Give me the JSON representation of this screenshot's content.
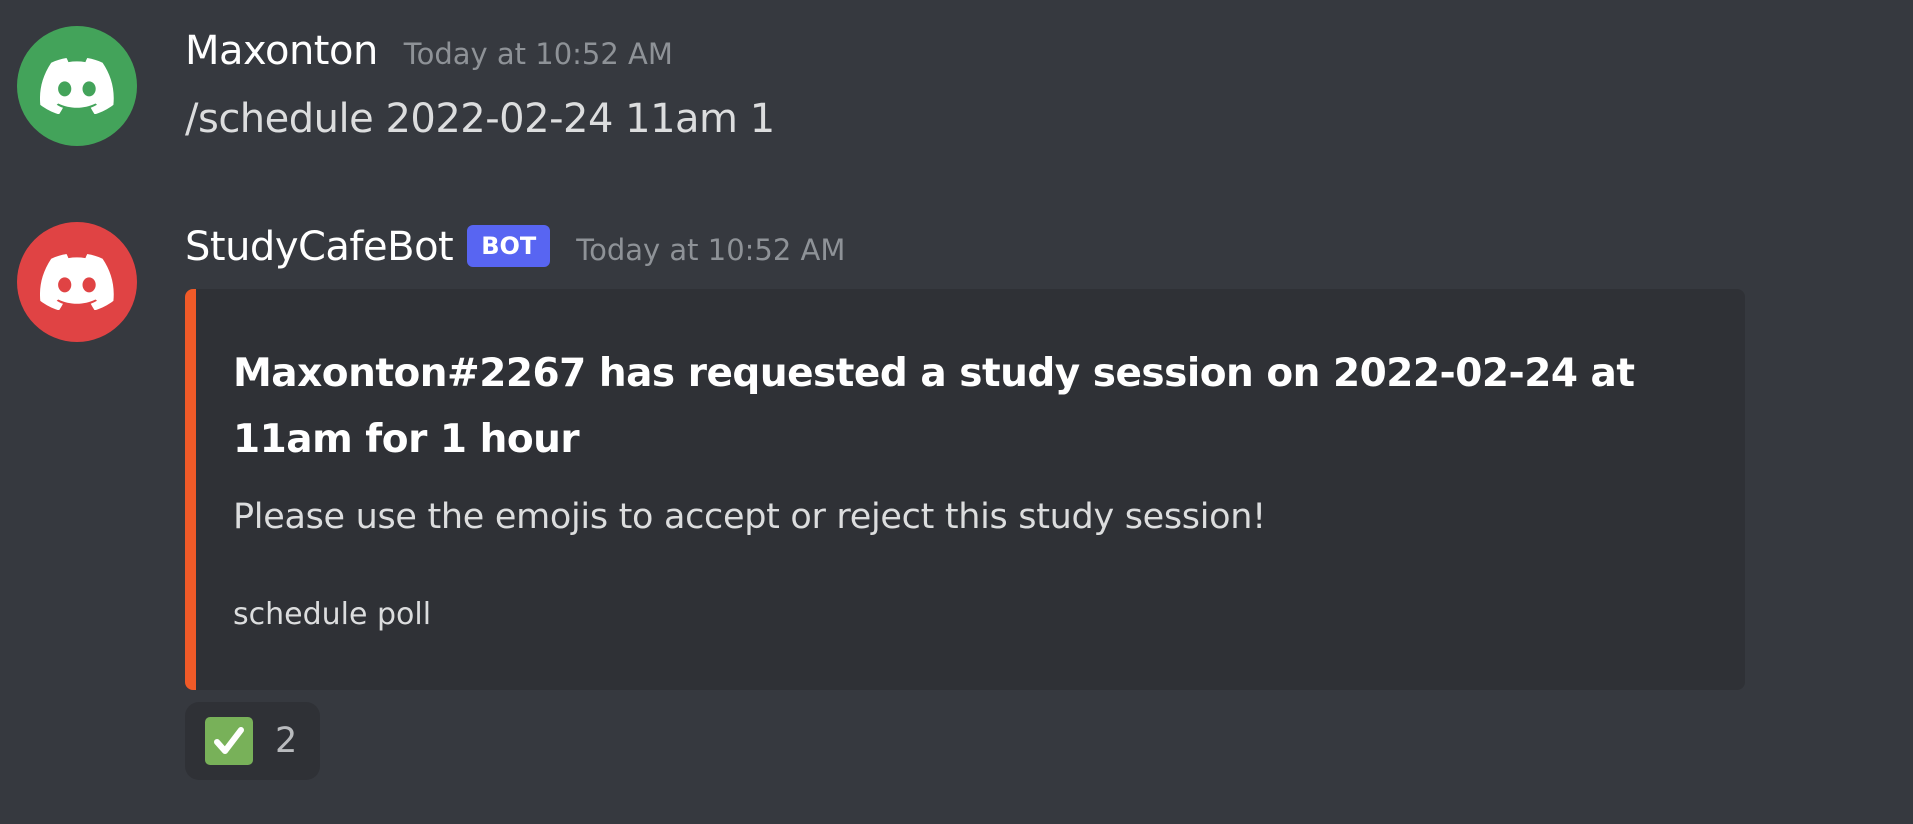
{
  "messages": [
    {
      "username": "Maxonton",
      "timestamp": "Today at 10:52 AM",
      "avatar_color": "#43a35a",
      "avatar_icon": "discord-logo-icon",
      "content": "/schedule 2022-02-24 11am 1"
    },
    {
      "username": "StudyCafeBot",
      "bot_tag": "BOT",
      "timestamp": "Today at 10:52 AM",
      "avatar_color": "#e04344",
      "avatar_icon": "discord-logo-icon",
      "embed": {
        "accent_color": "#f05a28",
        "title": "Maxonton#2267 has requested a study session on 2022-02-24 at 11am for 1 hour",
        "description": "Please use the emojis to accept or reject this study session!",
        "footer": "schedule poll"
      },
      "reactions": [
        {
          "emoji": "white-check-mark-icon",
          "count": "2"
        }
      ]
    }
  ],
  "colors": {
    "background": "#36393f",
    "embed_background": "#2f3136",
    "bot_tag": "#5865f2"
  }
}
